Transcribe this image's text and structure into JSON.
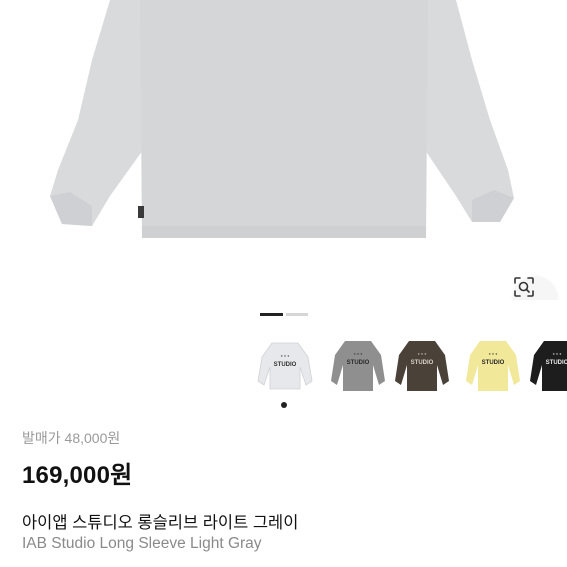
{
  "product": {
    "original_price_label": "발매가 48,000원",
    "price": "169,000원",
    "title_ko": "아이앱 스튜디오 롱슬리브 라이트 그레이",
    "title_en": "IAB Studio Long Sleeve Light Gray"
  },
  "gallery": {
    "page_indicator": {
      "count": 2,
      "active_index": 0
    },
    "selected_thumbnail": 0,
    "thumbnails": [
      {
        "color": "#e7e8ec",
        "name": "light-gray-longsleeve-thumbnail"
      },
      {
        "color": "#8f8f8f",
        "name": "gray-longsleeve-thumbnail"
      },
      {
        "color": "#4a4238",
        "name": "brown-longsleeve-thumbnail"
      },
      {
        "color": "#f1e89a",
        "name": "yellow-longsleeve-thumbnail"
      },
      {
        "color": "#1d1d1d",
        "name": "black-longsleeve-thumbnail"
      }
    ]
  },
  "icons": {
    "lens": "image-search-icon"
  },
  "colors": {
    "shirt": "#d7d8da",
    "text_primary": "#111111",
    "text_secondary": "#8a8a8a"
  }
}
